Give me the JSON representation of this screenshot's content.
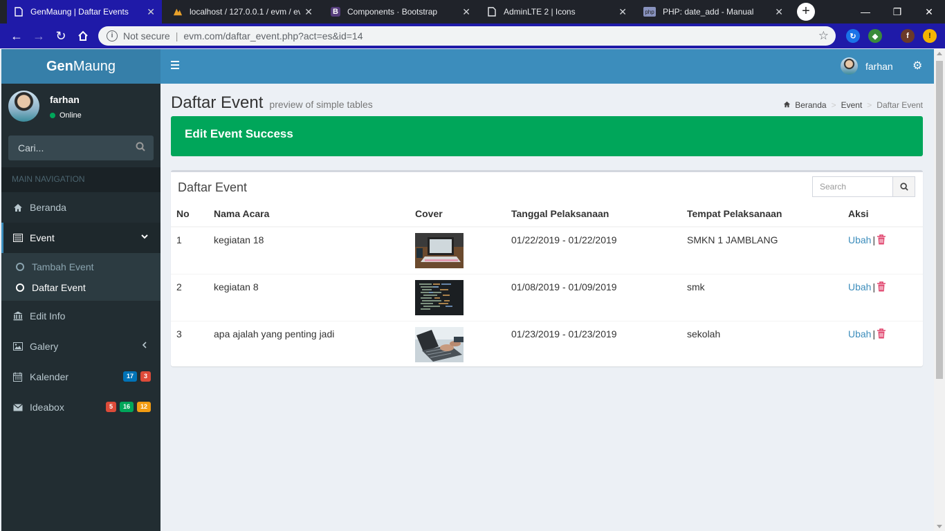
{
  "browser": {
    "tabs": [
      {
        "title": "GenMaung | Daftar Events",
        "icon": "page-icon"
      },
      {
        "title": "localhost / 127.0.0.1 / evm / ev",
        "icon": "phpmyadmin-icon"
      },
      {
        "title": "Components · Bootstrap",
        "icon": "bootstrap-icon"
      },
      {
        "title": "AdminLTE 2 | Icons",
        "icon": "page-icon"
      },
      {
        "title": "PHP: date_add - Manual",
        "icon": "php-icon"
      }
    ],
    "security_label": "Not secure",
    "url": "evm.com/daftar_event.php?act=es&id=14",
    "profile_initial": "f",
    "alert_glyph": "!"
  },
  "app": {
    "logo_bold": "Gen",
    "logo_light": "Maung",
    "user_name": "farhan",
    "user_status": "Online",
    "search_placeholder": "Cari...",
    "nav_header": "MAIN NAVIGATION",
    "menu": {
      "beranda": "Beranda",
      "event": "Event",
      "tambah_event": "Tambah Event",
      "daftar_event": "Daftar Event",
      "edit_info": "Edit Info",
      "galery": "Galery",
      "kalender": "Kalender",
      "kalender_badges": [
        "17",
        "3"
      ],
      "ideabox": "Ideabox",
      "ideabox_badges": [
        "5",
        "16",
        "12"
      ]
    },
    "colors": {
      "primary": "#3c8dbc",
      "success": "#00a65a",
      "danger": "#dd4b39",
      "warning": "#f39c12",
      "sidebar": "#222d32"
    }
  },
  "topbar": {
    "user_name": "farhan"
  },
  "page": {
    "title": "Daftar Event",
    "subtitle": "preview of simple tables",
    "breadcrumb": [
      "Beranda",
      "Event",
      "Daftar Event"
    ],
    "alert": "Edit Event Success",
    "box_title": "Daftar Event",
    "box_search_placeholder": "Search",
    "table": {
      "headers": [
        "No",
        "Nama Acara",
        "Cover",
        "Tanggal Pelaksanaan",
        "Tempat Pelaksanaan",
        "Aksi"
      ],
      "rows": [
        {
          "no": "1",
          "nama": "kegiatan 18",
          "cover": "laptop-desk-photo",
          "tanggal": "01/22/2019 - 01/22/2019",
          "tempat": "SMKN 1 JAMBLANG",
          "edit": "Ubah",
          "sep": "|"
        },
        {
          "no": "2",
          "nama": "kegiatan 8",
          "cover": "code-screen-photo",
          "tanggal": "01/08/2019 - 01/09/2019",
          "tempat": "smk",
          "edit": "Ubah",
          "sep": "|"
        },
        {
          "no": "3",
          "nama": "apa ajalah yang penting jadi",
          "cover": "typing-laptop-photo",
          "tanggal": "01/23/2019 - 01/23/2019",
          "tempat": "sekolah",
          "edit": "Ubah",
          "sep": "|"
        }
      ]
    }
  }
}
